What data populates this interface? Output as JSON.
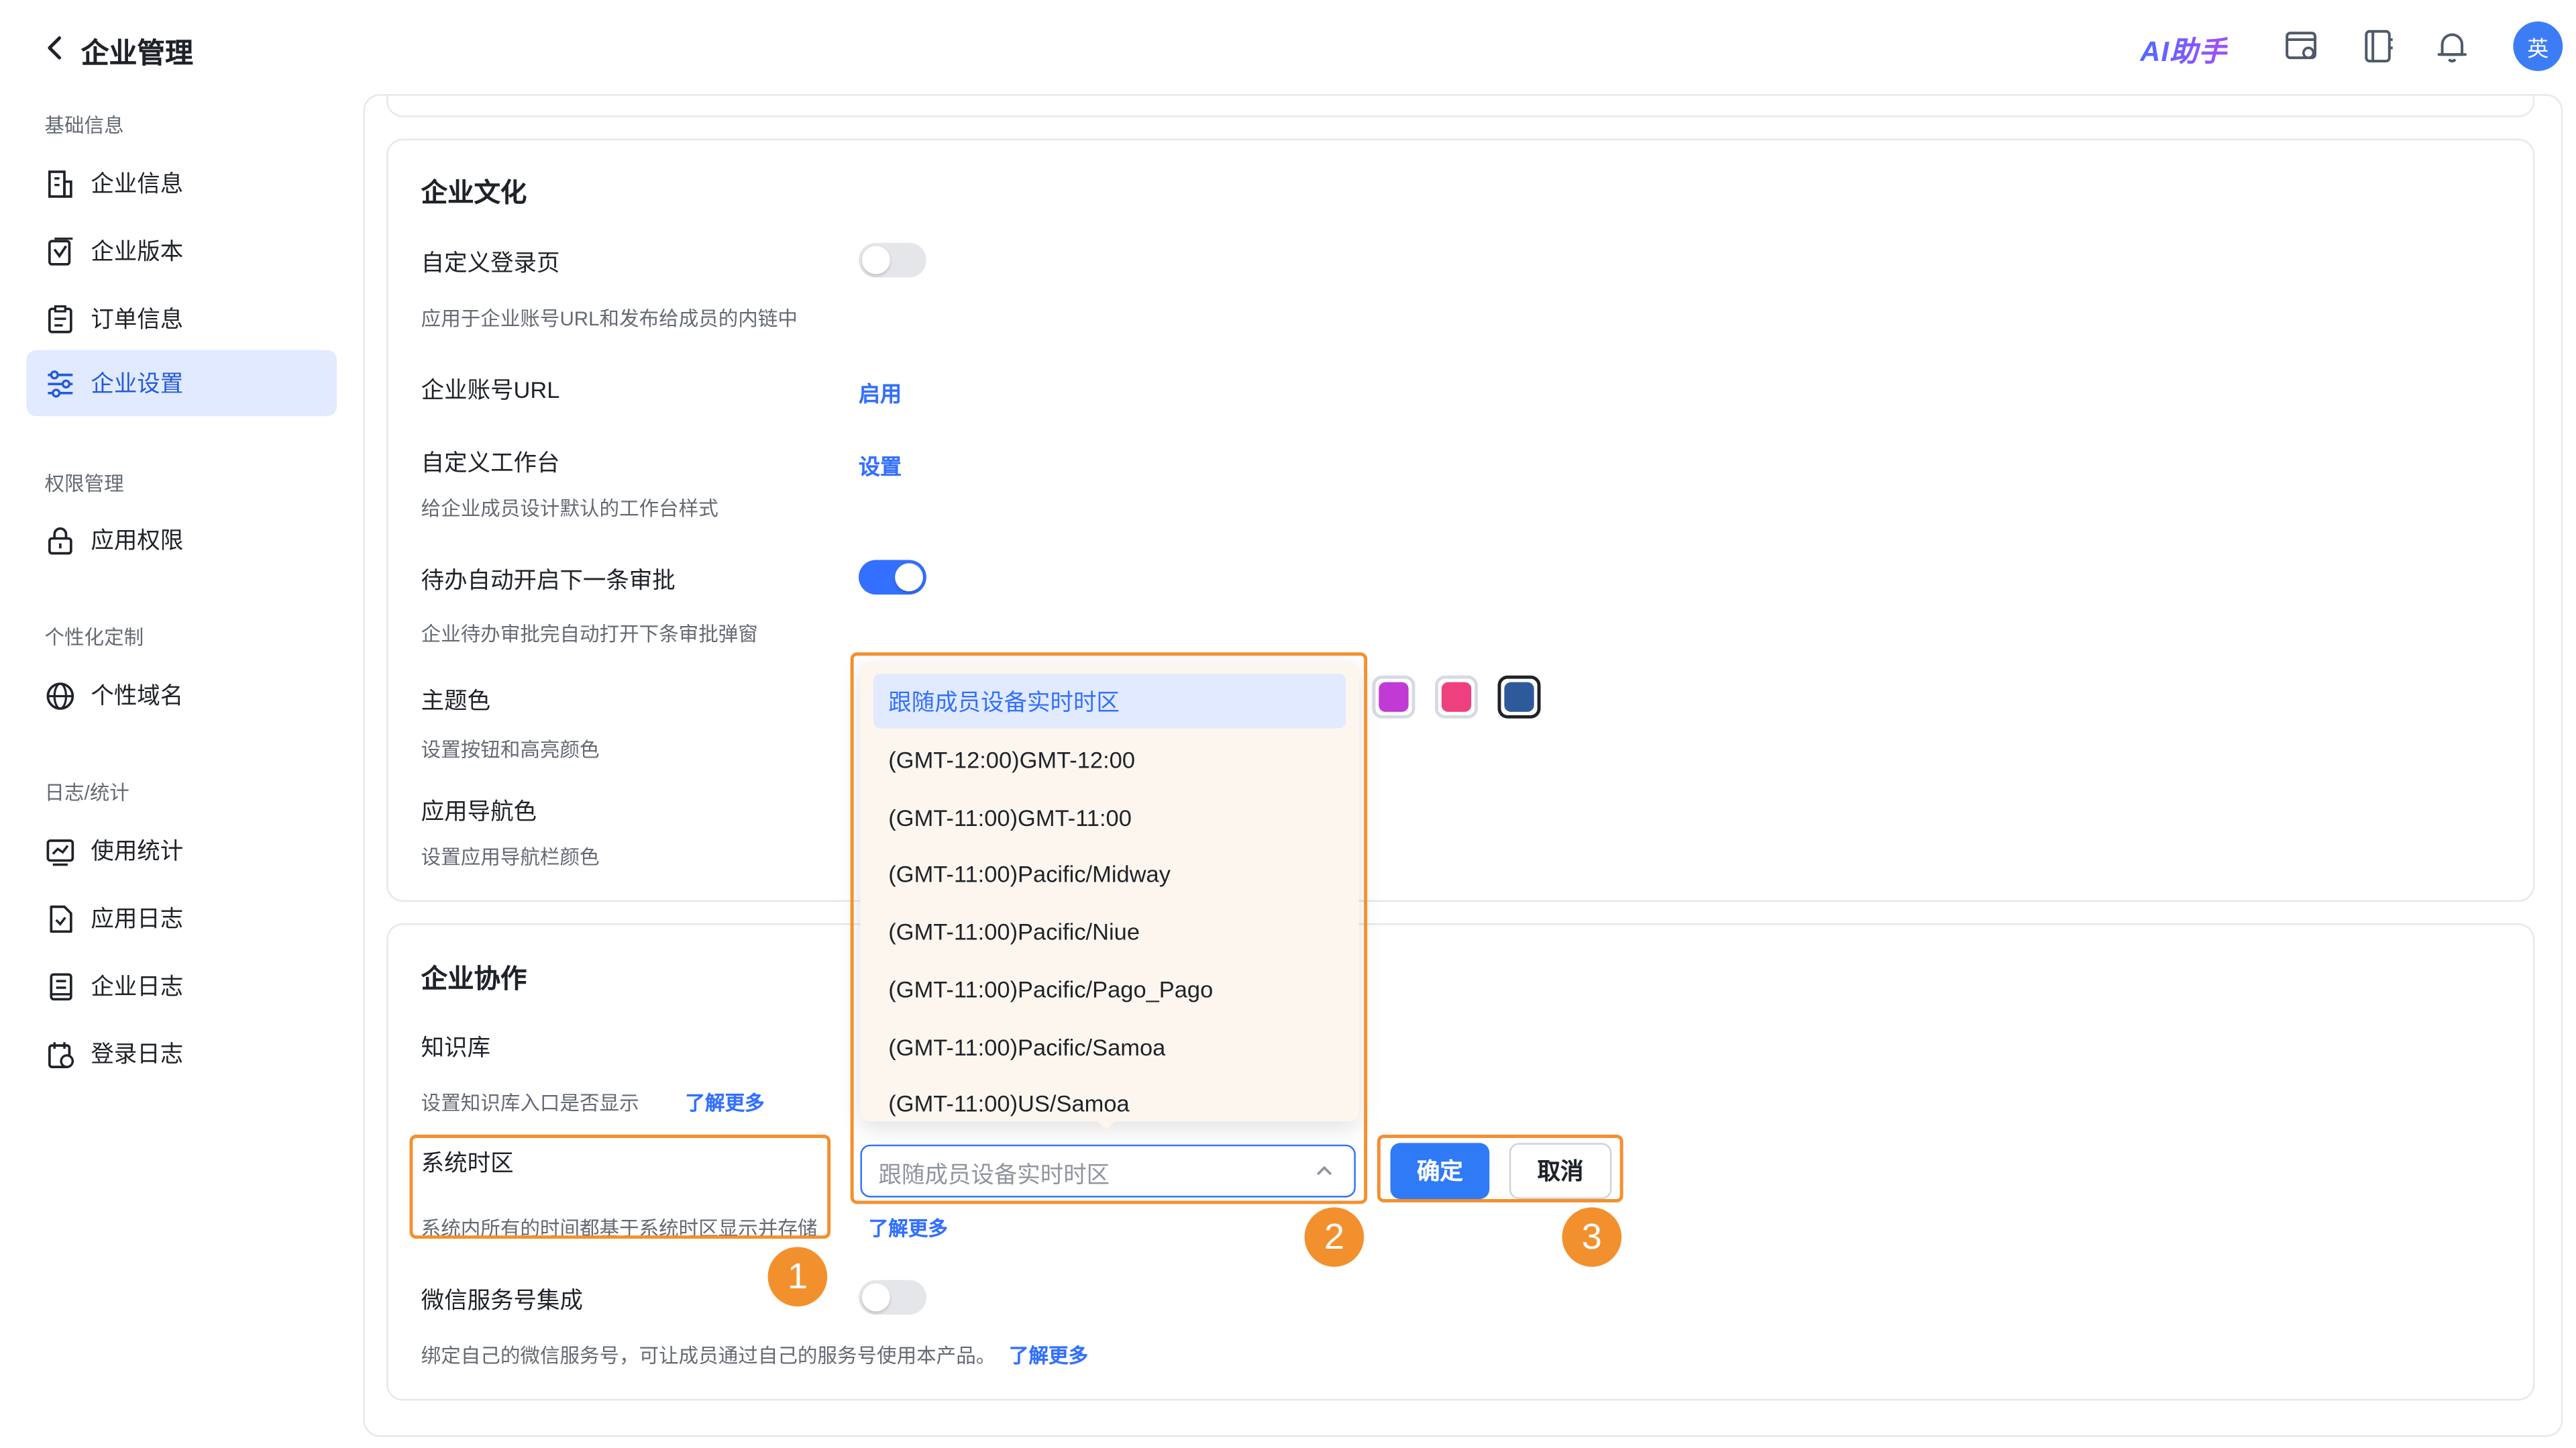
{
  "header": {
    "title": "企业管理",
    "ai_label": "AI助手",
    "avatar_text": "英"
  },
  "sidebar": {
    "sections": [
      {
        "label": "基础信息"
      },
      {
        "label": "权限管理"
      },
      {
        "label": "个性化定制"
      },
      {
        "label": "日志/统计"
      }
    ],
    "items": [
      {
        "label": "企业信息",
        "icon": "building-icon"
      },
      {
        "label": "企业版本",
        "icon": "version-icon"
      },
      {
        "label": "订单信息",
        "icon": "order-icon"
      },
      {
        "label": "企业设置",
        "icon": "settings-sliders-icon",
        "active": true
      },
      {
        "label": "应用权限",
        "icon": "lock-icon"
      },
      {
        "label": "个性域名",
        "icon": "globe-icon"
      },
      {
        "label": "使用统计",
        "icon": "chart-icon"
      },
      {
        "label": "应用日志",
        "icon": "app-log-icon"
      },
      {
        "label": "企业日志",
        "icon": "doc-log-icon"
      },
      {
        "label": "登录日志",
        "icon": "calendar-log-icon"
      }
    ]
  },
  "culture": {
    "title": "企业文化",
    "custom_login": {
      "label": "自定义登录页",
      "desc": "应用于企业账号URL和发布给成员的内链中",
      "enabled": false
    },
    "account_url": {
      "label": "企业账号URL",
      "action": "启用"
    },
    "workbench": {
      "label": "自定义工作台",
      "action": "设置",
      "desc": "给企业成员设计默认的工作台样式"
    },
    "auto_next": {
      "label": "待办自动开启下一条审批",
      "desc": "企业待办审批完自动打开下条审批弹窗",
      "enabled": true
    },
    "theme": {
      "label": "主题色",
      "desc": "设置按钮和高亮颜色",
      "swatches": [
        "#c13ad6",
        "#ee3f7e",
        "#2f5a9a"
      ]
    },
    "nav_color": {
      "label": "应用导航色",
      "desc": "设置应用导航栏颜色"
    }
  },
  "collab": {
    "title": "企业协作",
    "knowledge": {
      "label": "知识库",
      "desc": "设置知识库入口是否显示",
      "link": "了解更多"
    },
    "timezone": {
      "label": "系统时区",
      "desc": "系统内所有的时间都基于系统时区显示并存储",
      "link": "了解更多",
      "value": "跟随成员设备实时时区",
      "options": [
        "跟随成员设备实时时区",
        "(GMT-12:00)GMT-12:00",
        "(GMT-11:00)GMT-11:00",
        "(GMT-11:00)Pacific/Midway",
        "(GMT-11:00)Pacific/Niue",
        "(GMT-11:00)Pacific/Pago_Pago",
        "(GMT-11:00)Pacific/Samoa",
        "(GMT-11:00)US/Samoa"
      ],
      "confirm": "确定",
      "cancel": "取消"
    },
    "wechat": {
      "label": "微信服务号集成",
      "desc": "绑定自己的微信服务号，可让成员通过自己的服务号使用本产品。",
      "link": "了解更多",
      "enabled": false
    }
  },
  "annotations": [
    "1",
    "2",
    "3"
  ],
  "colors": {
    "accent": "#3370ff",
    "annotation": "#f3902e"
  }
}
